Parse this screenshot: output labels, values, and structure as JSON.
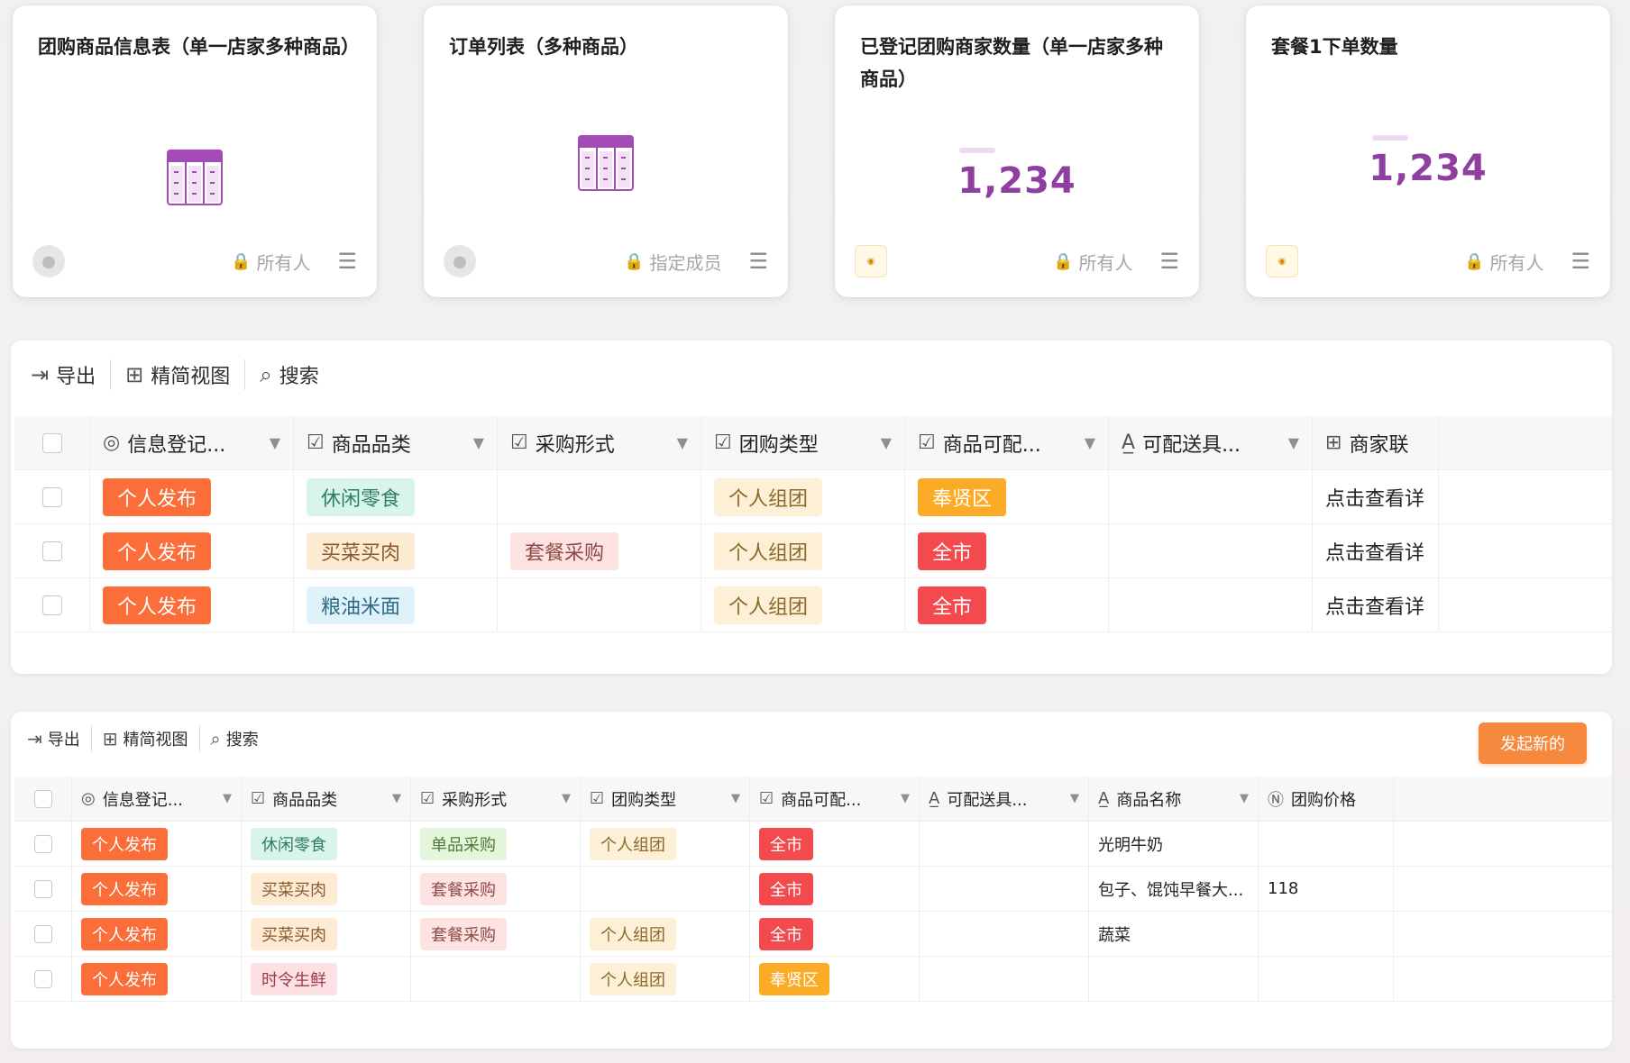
{
  "colors": {
    "accent": "#f7893f",
    "purple": "#8e3fa0",
    "tag_orange_red": "#fb6d39",
    "tag_red": "#f24a4d",
    "tag_yellow": "#fbab26"
  },
  "cards": [
    {
      "title": "团购商品信息表（单一店家多种商品）",
      "type": "table",
      "permission": "所有人",
      "avatar": "user-avatar"
    },
    {
      "title": "订单列表（多种商品）",
      "type": "table",
      "permission": "指定成员",
      "avatar": "user-avatar"
    },
    {
      "title": "已登记团购商家数量（单一店家多种商品）",
      "type": "number",
      "value": "1,234",
      "permission": "所有人",
      "avatar": "logo-avatar"
    },
    {
      "title": "套餐1下单数量",
      "type": "number",
      "value": "1,234",
      "permission": "所有人",
      "avatar": "logo-avatar"
    }
  ],
  "toolbar": {
    "export_label": "导出",
    "compact_view_label": "精简视图",
    "search_label": "搜索",
    "new_button_label": "发起新的"
  },
  "table1": {
    "columns": [
      {
        "icon": "◎",
        "label": "信息登记..."
      },
      {
        "icon": "☑",
        "label": "商品品类"
      },
      {
        "icon": "☑",
        "label": "采购形式"
      },
      {
        "icon": "☑",
        "label": "团购类型"
      },
      {
        "icon": "☑",
        "label": "商品可配..."
      },
      {
        "icon": "A̲",
        "label": "可配送具..."
      },
      {
        "icon": "⊞",
        "label": "商家联"
      }
    ],
    "rows": [
      {
        "c0": "个人发布",
        "c1": "休闲零食",
        "c2": "",
        "c3": "个人组团",
        "c4": "奉贤区",
        "c5": "",
        "c6": "点击查看详"
      },
      {
        "c0": "个人发布",
        "c1": "买菜买肉",
        "c2": "套餐采购",
        "c3": "个人组团",
        "c4": "全市",
        "c5": "",
        "c6": "点击查看详"
      },
      {
        "c0": "个人发布",
        "c1": "粮油米面",
        "c2": "",
        "c3": "个人组团",
        "c4": "全市",
        "c5": "",
        "c6": "点击查看详"
      }
    ]
  },
  "table2": {
    "columns": [
      {
        "icon": "◎",
        "label": "信息登记..."
      },
      {
        "icon": "☑",
        "label": "商品品类"
      },
      {
        "icon": "☑",
        "label": "采购形式"
      },
      {
        "icon": "☑",
        "label": "团购类型"
      },
      {
        "icon": "☑",
        "label": "商品可配..."
      },
      {
        "icon": "A̲",
        "label": "可配送具..."
      },
      {
        "icon": "A̲",
        "label": "商品名称"
      },
      {
        "icon": "Ⓝ",
        "label": "团购价格"
      }
    ],
    "rows": [
      {
        "c0": "个人发布",
        "c1": "休闲零食",
        "c2": "单品采购",
        "c3": "个人组团",
        "c4": "全市",
        "c5": "",
        "c6": "光明牛奶",
        "c7": ""
      },
      {
        "c0": "个人发布",
        "c1": "买菜买肉",
        "c2": "套餐采购",
        "c3": "",
        "c4": "全市",
        "c5": "",
        "c6": "包子、馄饨早餐大...",
        "c7": "118"
      },
      {
        "c0": "个人发布",
        "c1": "买菜买肉",
        "c2": "套餐采购",
        "c3": "个人组团",
        "c4": "全市",
        "c5": "",
        "c6": "蔬菜",
        "c7": ""
      },
      {
        "c0": "个人发布",
        "c1": "时令生鲜",
        "c2": "",
        "c3": "个人组团",
        "c4": "奉贤区",
        "c5": "",
        "c6": "",
        "c7": ""
      }
    ]
  }
}
